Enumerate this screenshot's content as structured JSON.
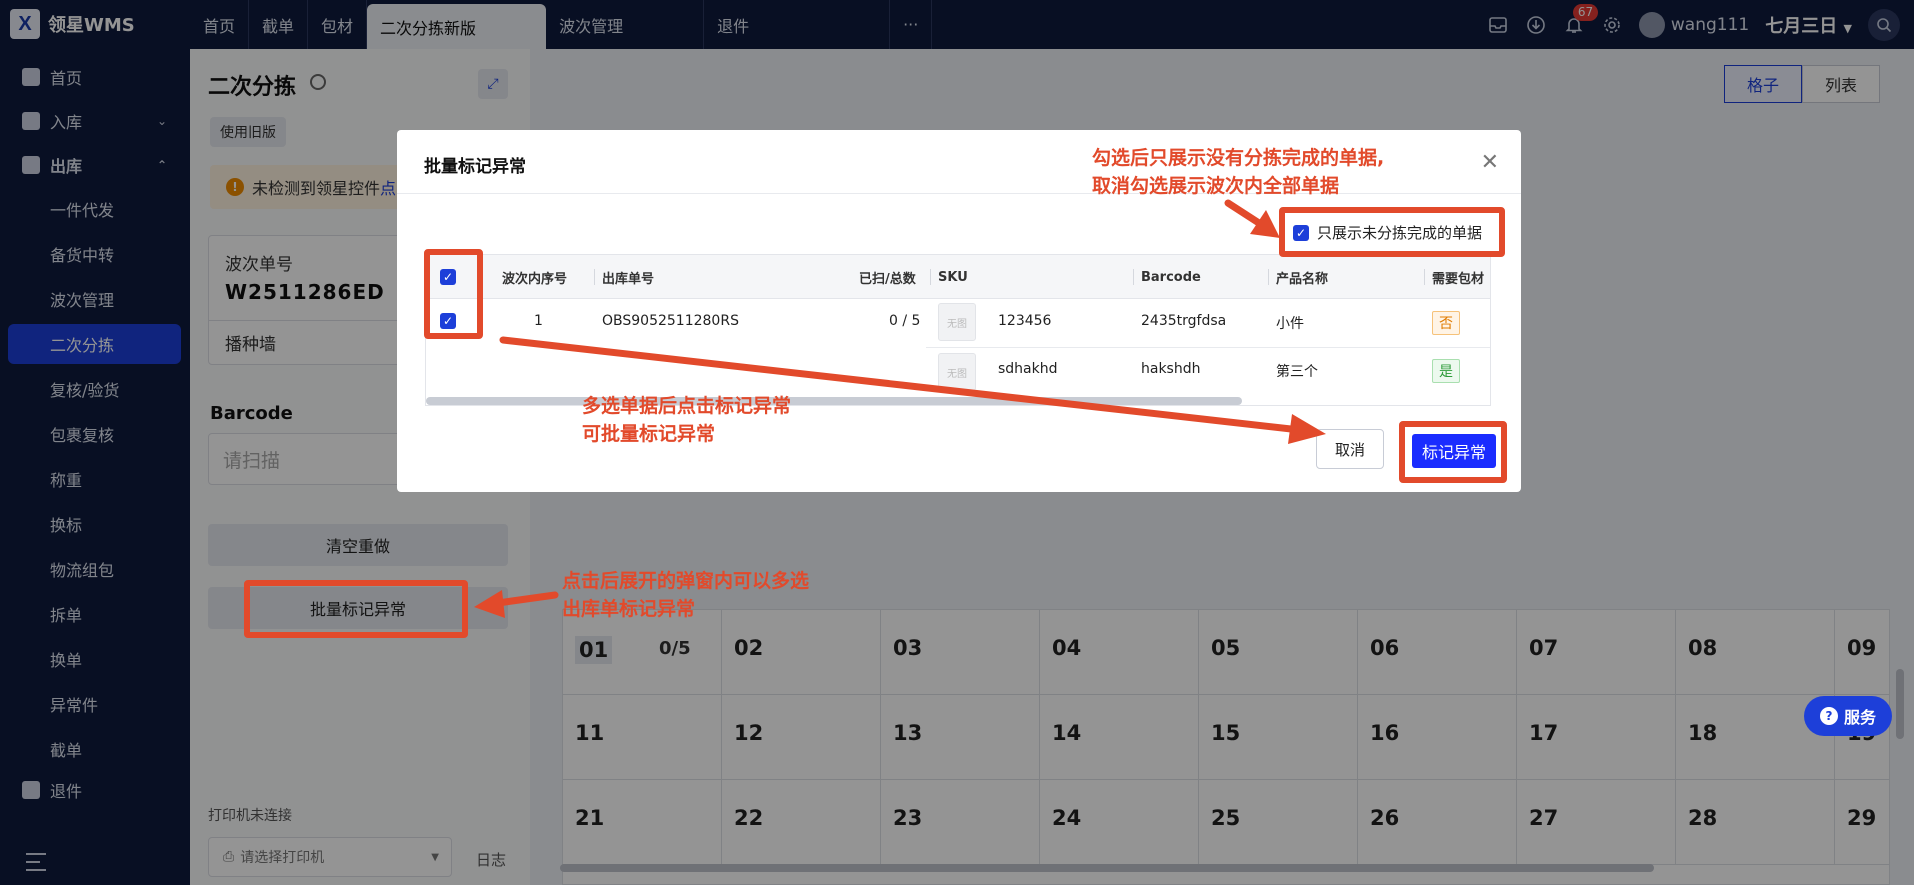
{
  "app": {
    "logo_mark": "X",
    "name": "领星WMS"
  },
  "topnav": {
    "tabs": [
      "首页",
      "截单",
      "包材",
      "二次分拣新版",
      "波次管理",
      "退件",
      "···"
    ],
    "active_index": 3
  },
  "topbar": {
    "notification_count": "67",
    "username": "wang111",
    "date": "七月三日"
  },
  "sidebar": {
    "items": [
      {
        "label": "首页",
        "type": "top",
        "icon": "home-icon"
      },
      {
        "label": "入库",
        "type": "top",
        "icon": "inbound-icon",
        "chevron": "⌄"
      },
      {
        "label": "出库",
        "type": "top",
        "icon": "outbound-icon",
        "chevron": "⌃"
      },
      {
        "label": "一件代发",
        "type": "sub"
      },
      {
        "label": "备货中转",
        "type": "sub"
      },
      {
        "label": "波次管理",
        "type": "sub"
      },
      {
        "label": "二次分拣",
        "type": "sub",
        "active": true
      },
      {
        "label": "复核/验货",
        "type": "sub"
      },
      {
        "label": "包裹复核",
        "type": "sub"
      },
      {
        "label": "称重",
        "type": "sub"
      },
      {
        "label": "换标",
        "type": "sub"
      },
      {
        "label": "物流组包",
        "type": "sub"
      },
      {
        "label": "拆单",
        "type": "sub"
      },
      {
        "label": "换单",
        "type": "sub"
      },
      {
        "label": "异常件",
        "type": "sub"
      },
      {
        "label": "截单",
        "type": "sub"
      },
      {
        "label": "退件",
        "type": "top",
        "icon": "return-icon"
      }
    ]
  },
  "left": {
    "title": "二次分拣",
    "old_version": "使用旧版",
    "warning_text": "未检测到领星控件",
    "warning_link": "点",
    "wave_label": "波次单号",
    "wave_no": "W2511286ED",
    "wall_label": "播种墙",
    "barcode_label": "Barcode",
    "barcode_placeholder": "请扫描",
    "clear_btn": "清空重做",
    "batch_btn": "批量标记异常",
    "printer_status": "打印机未连接",
    "printer_placeholder": "请选择打印机",
    "log": "日志"
  },
  "content": {
    "view_grid": "格子",
    "view_list": "列表",
    "cells": [
      "01",
      "02",
      "03",
      "04",
      "05",
      "06",
      "07",
      "08",
      "09",
      "11",
      "12",
      "13",
      "14",
      "15",
      "16",
      "17",
      "18",
      "19",
      "21",
      "22",
      "23",
      "24",
      "25",
      "26",
      "27",
      "28",
      "29"
    ],
    "first_cell_count": "0/5",
    "service": "服务"
  },
  "modal": {
    "title": "批量标记异常",
    "only_unfinished_label": "只展示未分拣完成的单据",
    "only_unfinished_checked": true,
    "columns": [
      "波次内序号",
      "出库单号",
      "已扫/总数",
      "SKU",
      "Barcode",
      "产品名称",
      "需要包材"
    ],
    "rows": [
      {
        "checked": true,
        "seq": "1",
        "order_no": "OBS9052511280RS",
        "scanned_total": "0 / 5",
        "items": [
          {
            "img": "无图",
            "sku": "123456",
            "barcode": "2435trgfdsa",
            "name": "小件",
            "need_pack": "否"
          },
          {
            "img": "无图",
            "sku": "sdhakhd",
            "barcode": "hakshdh",
            "name": "第三个",
            "need_pack": "是"
          }
        ]
      }
    ],
    "cancel": "取消",
    "confirm": "标记异常"
  },
  "annotations": {
    "checkbox_note_1": "勾选后只展示没有分拣完成的单据,",
    "checkbox_note_2": "取消勾选展示波次内全部单据",
    "multi_note_1": "多选单据后点击标记异常",
    "multi_note_2": "可批量标记异常",
    "batch_note_1": "点击后展开的弹窗内可以多选",
    "batch_note_2": "出库单标记异常",
    "color": "#e24a2b"
  },
  "colors": {
    "nav_bg": "#0f1b3d",
    "primary": "#1d3fd9",
    "confirm": "#1a2cff"
  }
}
